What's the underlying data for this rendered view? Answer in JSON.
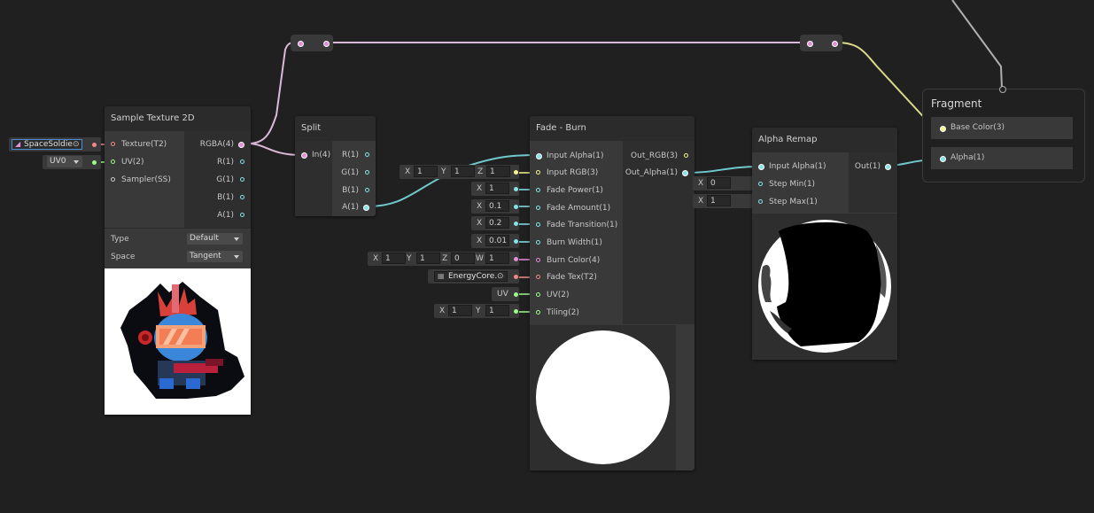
{
  "colors": {
    "background": "#202020",
    "wire_pink": "#dcb8d8",
    "wire_cyan": "#6fc9cc",
    "wire_yellow": "#d9d98a",
    "wire_grey": "#b0b0b0",
    "port_cyan": "#84e4e7",
    "port_pink": "#e38dd8",
    "port_green": "#9ef98b",
    "port_yellow": "#f4f58c",
    "port_red": "#f08a8a"
  },
  "sample_texture": {
    "title": "Sample Texture 2D",
    "inputs": [
      "Texture(T2)",
      "UV(2)",
      "Sampler(SS)"
    ],
    "outputs": [
      "RGBA(4)",
      "R(1)",
      "G(1)",
      "B(1)",
      "A(1)"
    ],
    "type_label": "Type",
    "type_value": "Default",
    "space_label": "Space",
    "space_value": "Tangent",
    "texture_value": "SpaceSoldie",
    "uv_value": "UV0"
  },
  "split": {
    "title": "Split",
    "inputs": [
      "In(4)"
    ],
    "outputs": [
      "R(1)",
      "G(1)",
      "B(1)",
      "A(1)"
    ]
  },
  "fade_burn": {
    "title": "Fade - Burn",
    "inputs": [
      "Input Alpha(1)",
      "Input RGB(3)",
      "Fade Power(1)",
      "Fade Amount(1)",
      "Fade Transition(1)",
      "Burn Width(1)",
      "Burn Color(4)",
      "Fade Tex(T2)",
      "UV(2)",
      "Tiling(2)"
    ],
    "outputs": [
      "Out_RGB(3)",
      "Out_Alpha(1)"
    ],
    "defaults": {
      "input_rgb": {
        "x": "1",
        "y": "1",
        "z": "1"
      },
      "fade_power": {
        "x": "1"
      },
      "fade_amount": {
        "x": "0.1"
      },
      "fade_transition": {
        "x": "0.2"
      },
      "burn_width": {
        "x": "0.01"
      },
      "burn_color": {
        "x": "1",
        "y": "1",
        "z": "0",
        "w": "1"
      },
      "fade_tex": "EnergyCore.",
      "uv": "UV",
      "tiling": {
        "x": "1",
        "y": "1"
      }
    }
  },
  "alpha_remap": {
    "title": "Alpha Remap",
    "inputs": [
      "Input Alpha(1)",
      "Step Min(1)",
      "Step Max(1)"
    ],
    "outputs": [
      "Out(1)"
    ],
    "defaults": {
      "step_min": {
        "x": "0"
      },
      "step_max": {
        "x": "1"
      }
    }
  },
  "fragment": {
    "title": "Fragment",
    "inputs": [
      "Base Color(3)",
      "Alpha(1)"
    ]
  },
  "axis_labels": {
    "x": "X",
    "y": "Y",
    "z": "Z",
    "w": "W"
  }
}
